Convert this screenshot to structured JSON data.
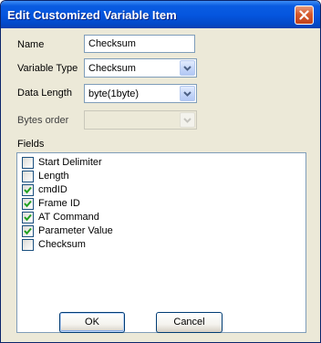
{
  "window": {
    "title": "Edit Customized Variable Item"
  },
  "form": {
    "name_label": "Name",
    "name_value": "Checksum",
    "variable_type_label": "Variable Type",
    "variable_type_value": "Checksum",
    "data_length_label": "Data Length",
    "data_length_value": "byte(1byte)",
    "bytes_order_label": "Bytes order",
    "bytes_order_value": ""
  },
  "fields": {
    "label": "Fields",
    "items": [
      {
        "label": "Start Delimiter",
        "checked": false
      },
      {
        "label": "Length",
        "checked": false
      },
      {
        "label": "cmdID",
        "checked": true
      },
      {
        "label": "Frame ID",
        "checked": true
      },
      {
        "label": "AT Command",
        "checked": true
      },
      {
        "label": "Parameter Value",
        "checked": true
      },
      {
        "label": "Checksum",
        "checked": false
      }
    ]
  },
  "buttons": {
    "ok": "OK",
    "cancel": "Cancel"
  },
  "icons": {
    "close": "close-icon",
    "dropdown": "chevron-down-icon",
    "check": "checkmark-icon"
  },
  "colors": {
    "titlebar": "#0556df",
    "dialog_background": "#ece9d8",
    "close_button": "#d65a2d",
    "checkmark": "#21a121"
  }
}
